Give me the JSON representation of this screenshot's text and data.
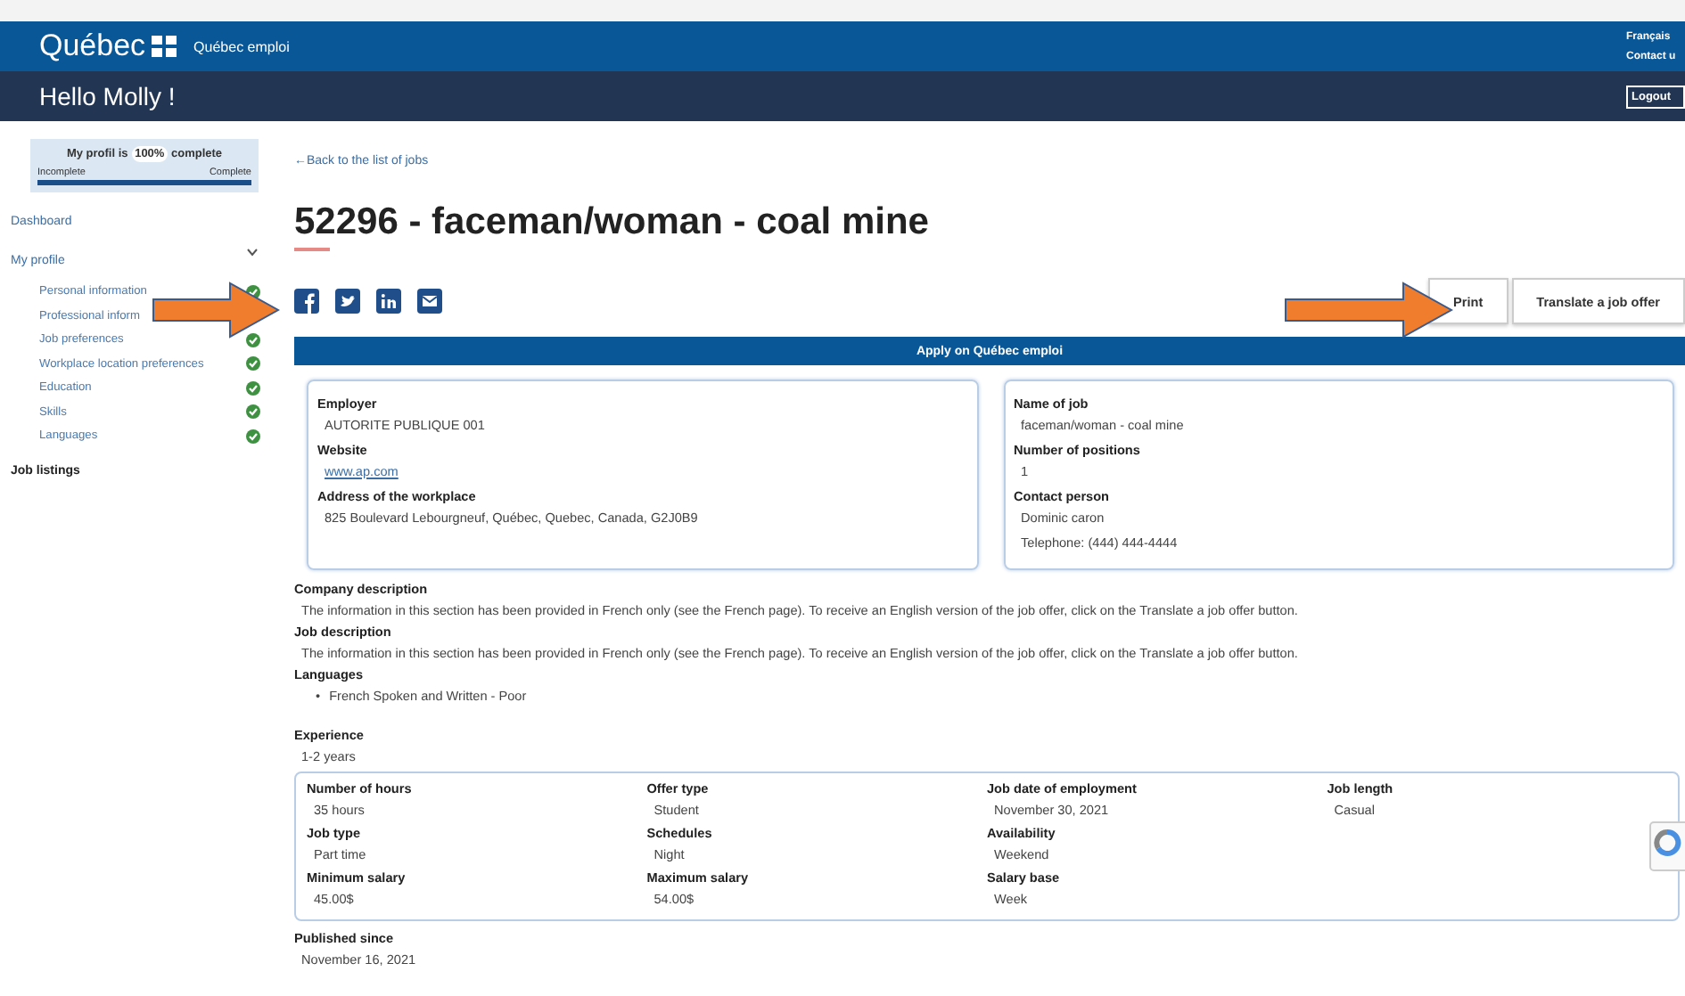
{
  "header": {
    "logo": "Québec",
    "site": "Québec emploi",
    "links": [
      "Français",
      "Contact u"
    ],
    "greeting": "Hello Molly !",
    "logout": "Logout"
  },
  "sidebar": {
    "profile": {
      "prefix": "My profil is",
      "percent": "100%",
      "suffix": "complete",
      "incomplete": "Incomplete",
      "complete": "Complete",
      "level": 1
    },
    "dashboard": "Dashboard",
    "my_profile": {
      "label": "My profile",
      "expanded": true,
      "children": [
        {
          "label": "Personal information",
          "checked": true
        },
        {
          "label": "Professional inform"
        },
        {
          "label": "Job preferences",
          "checked": true
        },
        {
          "label": "Workplace location preferences",
          "checked": true
        },
        {
          "label": "Education",
          "checked": true
        },
        {
          "label": "Skills",
          "checked": true
        },
        {
          "label": "Languages",
          "checked": true
        }
      ]
    },
    "job_listings": "Job listings"
  },
  "main": {
    "back": "←Back to the list of jobs",
    "title": "52296 - faceman/woman - coal mine",
    "buttons": [
      "Print",
      "Translate a job offer"
    ],
    "apply": "Apply on Québec emploi",
    "cards": [
      [
        {
          "label": "Employer",
          "value": "AUTORITE PUBLIQUE 001",
          "kind": "text"
        },
        {
          "label": "Website",
          "value": "www.ap.com",
          "kind": "link"
        },
        {
          "label": "Address of the workplace",
          "value": "825 Boulevard Lebourgneuf, Québec, Quebec, Canada, G2J0B9",
          "kind": "text"
        }
      ],
      [
        {
          "label": "Name of job",
          "value": "faceman/woman - coal mine",
          "kind": "text"
        },
        {
          "label": "Number of positions",
          "value": "1",
          "kind": "text"
        },
        {
          "label": "Contact person",
          "value": "Dominic caron",
          "value2": "Telephone: (444) 444-4444",
          "kind": "text"
        }
      ]
    ],
    "sections": [
      {
        "label": "Company description",
        "text": "The information in this section has been provided in French only (see the French page). To receive an English version of the job offer, click on the Translate a job offer button.",
        "kind": "text"
      },
      {
        "label": "Job description",
        "text": "The information in this section has been provided in French only (see the French page). To receive an English version of the job offer, click on the Translate a job offer button.",
        "kind": "text"
      },
      {
        "label": "Languages",
        "bullet": "•",
        "items": [
          "French Spoken and Written - Poor"
        ],
        "kind": "list"
      },
      {
        "label": "Experience",
        "text": "1-2 years",
        "kind": "text"
      }
    ],
    "details": [
      [
        {
          "label": "Number of hours",
          "value": "35 hours"
        },
        {
          "label": "Offer type",
          "value": "Student"
        },
        {
          "label": "Job date of employment",
          "value": "November 30, 2021"
        },
        {
          "label": "Job length",
          "value": "Casual"
        }
      ],
      [
        {
          "label": "Job type",
          "value": "Part time"
        },
        {
          "label": "Schedules",
          "value": "Night"
        },
        {
          "label": "Availability",
          "value": "Weekend"
        }
      ],
      [
        {
          "label": "Minimum salary",
          "value": "45.00$"
        },
        {
          "label": "Maximum salary",
          "value": "54.00$"
        },
        {
          "label": "Salary base",
          "value": "Week"
        }
      ]
    ],
    "published": {
      "label": "Published since",
      "value": "November 16, 2021"
    }
  }
}
